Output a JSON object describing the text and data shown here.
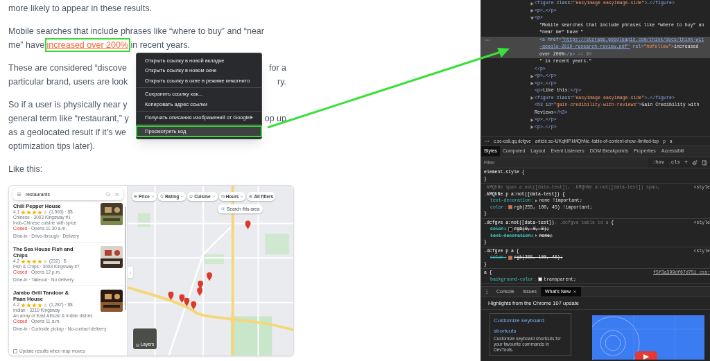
{
  "article": {
    "blocks": [
      {
        "kind": "plain",
        "lines": [
          "more likely to appear in these results."
        ]
      },
      {
        "kind": "linked",
        "lines": [
          "Mobile searches that include phrases like “where to buy” and “near",
          "me” have "
        ],
        "link": "increased over 200%",
        "after": " in recent years."
      },
      {
        "kind": "covered",
        "lines": [
          {
            "left": "These are considered “discove",
            "right": "for a"
          },
          {
            "left": "particular brand, users are look",
            "right": "ry."
          }
        ]
      },
      {
        "kind": "covered",
        "lines": [
          {
            "left": "So if a user is physically near y"
          },
          {
            "left": "general term like “restaurant,” y",
            "right": "op up"
          },
          {
            "left": "as a geolocated result if it’s we"
          },
          {
            "left": "optimization tips later)."
          }
        ]
      },
      {
        "kind": "plain",
        "lines": [
          "Like this:"
        ]
      }
    ]
  },
  "map_screenshot": {
    "search": {
      "value": "restaurants"
    },
    "results": [
      {
        "title": "Chili Pepper House",
        "rating": "4.1",
        "stars": 4,
        "reviews": "(1,563) · $$",
        "lines": [
          "Chinese · 3003 Kingsway #1",
          "Indo-Chinese cuisine with spice"
        ],
        "status": "Closed",
        "hours": " · Opens 11:30 a.m.",
        "services": "Dine-in · Drive-through · Delivery"
      },
      {
        "title": "The Sea House Fish and Chips",
        "rating": "4.2",
        "stars": 4,
        "reviews": "(232) · $",
        "lines": [
          "Fish & Chips · 3003 Kingsway #7"
        ],
        "status": "Closed",
        "hours": " · Opens 12 p.m.",
        "services": "Dine-in · Takeout · No delivery"
      },
      {
        "title": "Jambo Grill Tandoor & Paan House",
        "rating": "4.2",
        "stars": 4,
        "reviews": "(1,287) · $$",
        "lines": [
          "Indian · 3219 Kingsway",
          "An array of East African & Indian dishes"
        ],
        "status": "Closed",
        "hours": " · Opens 11 a.m.",
        "services": "Dine-in · Curbside pickup · No-contact delivery"
      }
    ],
    "update_option": {
      "label": "Update results when map moves",
      "checked": false
    },
    "chips": [
      {
        "label": "Price",
        "dropdown": true
      },
      {
        "label": "Rating",
        "dropdown": true
      },
      {
        "label": "Cuisine",
        "dropdown": true
      },
      {
        "label": "Hours",
        "dropdown": true
      },
      {
        "label": "All filters",
        "dropdown": false
      }
    ],
    "search_area": "Search this area",
    "layers": "Layers"
  },
  "context_menu": {
    "groups": [
      [
        {
          "label": "Открыть ссылку в новой вкладке",
          "highlighted": false,
          "submenu": false
        },
        {
          "label": "Открыть ссылку в новом окне",
          "highlighted": false,
          "submenu": false
        },
        {
          "label": "Открыть ссылку в окне в режиме инкогнито",
          "highlighted": false,
          "submenu": false
        }
      ],
      [
        {
          "label": "Сохранить ссылку как...",
          "highlighted": false,
          "submenu": false
        },
        {
          "label": "Копировать адрес ссылки",
          "highlighted": false,
          "submenu": false
        }
      ],
      [
        {
          "label": "Получать описания изображений от Google",
          "highlighted": false,
          "submenu": true
        }
      ],
      [
        {
          "label": "Просмотреть код",
          "highlighted": true,
          "submenu": false
        }
      ]
    ]
  },
  "elements": {
    "nodes": [
      {
        "selected": false,
        "expanded": false,
        "lines": [
          [
            {
              "kind": "tag",
              "text": "<figure"
            },
            {
              "kind": "attr",
              "text": " class"
            },
            {
              "kind": "tag",
              "text": "="
            },
            {
              "kind": "value",
              "text": "\"easyimage easyimage-side\""
            },
            {
              "kind": "tag",
              "text": ">…</figure>"
            }
          ]
        ]
      },
      {
        "selected": false,
        "expanded": false,
        "lines": [
          [
            {
              "kind": "tag",
              "text": "<p>…</p>"
            }
          ]
        ]
      },
      {
        "selected": false,
        "expanded": true,
        "lines": [
          [
            {
              "kind": "tag",
              "text": "<p>"
            }
          ]
        ],
        "close": [
          {
            "kind": "tag",
            "text": "</p>"
          }
        ],
        "children": [
          {
            "selected": false,
            "lines": [
              [
                {
                  "kind": "text",
                  "text": "\"Mobile searches that include phrases like “where to buy” an"
                }
              ],
              [
                {
                  "kind": "text",
                  "text": "“near me” have \""
                }
              ]
            ]
          },
          {
            "selected": true,
            "lines": [
              [
                {
                  "kind": "tag",
                  "text": "<a"
                },
                {
                  "kind": "attr",
                  "text": " href"
                },
                {
                  "kind": "tag",
                  "text": "="
                },
                {
                  "kind": "link",
                  "text": "\"https://storage.googleapis.com/think/docs/think-wit"
                }
              ],
              [
                {
                  "kind": "link",
                  "text": "-google-2019-research-review.pdf\""
                },
                {
                  "kind": "attr",
                  "text": " rel"
                },
                {
                  "kind": "tag",
                  "text": "="
                },
                {
                  "kind": "value",
                  "text": "\"nofollow\""
                },
                {
                  "kind": "tag",
                  "text": ">"
                },
                {
                  "kind": "text",
                  "text": "increased"
                }
              ],
              [
                {
                  "kind": "text",
                  "text": "over 200%"
                },
                {
                  "kind": "tag",
                  "text": "</a>"
                },
                {
                  "kind": "dim",
                  "text": " == $0"
                }
              ]
            ]
          },
          {
            "selected": false,
            "lines": [
              [
                {
                  "kind": "text",
                  "text": "\" in recent years.\""
                }
              ]
            ]
          }
        ]
      },
      {
        "selected": false,
        "expanded": false,
        "lines": [
          [
            {
              "kind": "tag",
              "text": "<p>…</p>"
            }
          ]
        ]
      },
      {
        "selected": false,
        "expanded": false,
        "lines": [
          [
            {
              "kind": "tag",
              "text": "<p>…</p>"
            }
          ]
        ]
      },
      {
        "selected": false,
        "lines": [
          [
            {
              "kind": "tag",
              "text": "<p>"
            },
            {
              "kind": "text",
              "text": "Like this:"
            },
            {
              "kind": "tag",
              "text": "</p>"
            }
          ]
        ]
      },
      {
        "selected": false,
        "expanded": false,
        "lines": [
          [
            {
              "kind": "tag",
              "text": "<figure"
            },
            {
              "kind": "attr",
              "text": " class"
            },
            {
              "kind": "tag",
              "text": "="
            },
            {
              "kind": "value",
              "text": "\"easyimage easyimage-side\""
            },
            {
              "kind": "tag",
              "text": ">…</figure>"
            }
          ]
        ]
      },
      {
        "selected": false,
        "lines": [
          [
            {
              "kind": "tag",
              "text": "<h3"
            },
            {
              "kind": "attr",
              "text": " id"
            },
            {
              "kind": "tag",
              "text": "="
            },
            {
              "kind": "value",
              "text": "\"gain-credibility-with-reviews\""
            },
            {
              "kind": "tag",
              "text": ">"
            },
            {
              "kind": "text",
              "text": "Gain Credibility with"
            }
          ],
          [
            {
              "kind": "text",
              "text": "Reviews"
            },
            {
              "kind": "tag",
              "text": "</h3>"
            }
          ]
        ]
      },
      {
        "selected": false,
        "expanded": false,
        "lines": [
          [
            {
              "kind": "tag",
              "text": "<p>…</p>"
            }
          ]
        ]
      },
      {
        "selected": false,
        "expanded": false,
        "lines": [
          [
            {
              "kind": "tag",
              "text": "<p>…</p>"
            }
          ]
        ]
      }
    ]
  },
  "breadcrumbs": [
    "c.sc-caiLqq.dcfgve",
    "article.sc-iUKqMP.kMQhNe.-table-of-content-show.-limited-top",
    "p",
    "a"
  ],
  "sidebar_tabs": [
    {
      "label": "Styles",
      "selected": true
    },
    {
      "label": "Computed",
      "selected": false
    },
    {
      "label": "Layout",
      "selected": false
    },
    {
      "label": "Event Listeners",
      "selected": false
    },
    {
      "label": "DOM Breakpoints",
      "selected": false
    },
    {
      "label": "Properties",
      "selected": false
    },
    {
      "label": "Accessibili",
      "selected": false
    }
  ],
  "styles_toolbar": {
    "filter_placeholder": "Filter",
    "hov": ":hov",
    "cls": ".cls",
    "add": "+"
  },
  "style_rules": [
    {
      "selectors": [
        [
          {
            "text": "element.style {",
            "matched": true
          }
        ]
      ],
      "close": "}"
    },
    {
      "source": "<style",
      "selectors": [
        [
          {
            "text": ".kMQhNe span a:not([data-test]), .kMQhNe a:not([data-test]) span,",
            "matched": false
          }
        ],
        [
          {
            "text": ".kMQhNe p a:not([data-test])",
            "matched": true
          },
          {
            "text": " {",
            "matched": true
          }
        ]
      ],
      "properties": [
        {
          "name": "text-decoration:",
          "value": "none !important;",
          "expandable": true,
          "struck": false
        },
        {
          "name": "color:",
          "value": "rgb(255, 100, 45) !important;",
          "color": "#ff642d",
          "expandable": false,
          "struck": false
        }
      ],
      "close": "}"
    },
    {
      "source": "<style",
      "selectors": [
        [
          {
            "text": ".dcfgve a:not([data-test])",
            "matched": true
          },
          {
            "text": ", .dcfgve table td a",
            "matched": false
          },
          {
            "text": " {",
            "matched": true
          }
        ]
      ],
      "properties": [
        {
          "name": "color:",
          "value": "rgb(0, 0, 0);",
          "color": "#000000",
          "expandable": false,
          "struck": true
        },
        {
          "name": "text-decoration:",
          "value": "none;",
          "expandable": true,
          "struck": true
        }
      ],
      "close": "}"
    },
    {
      "source": "<style",
      "selectors": [
        [
          {
            "text": ".dcfgve p a {",
            "matched": true
          }
        ]
      ],
      "properties": [
        {
          "name": "color:",
          "value": "rgb(255, 100, 45);",
          "color": "#ff642d",
          "expandable": false,
          "struck": true
        }
      ],
      "close": "}"
    },
    {
      "source": "f5f3a399df67d751.css:",
      "selectors": [
        [
          {
            "text": "a {",
            "matched": true
          }
        ]
      ],
      "properties": [
        {
          "name": "background-color:",
          "value": "transparent;",
          "color": "#ffffff",
          "expandable": false,
          "struck": false
        }
      ]
    }
  ],
  "drawer": {
    "tabs": [
      {
        "label": "Console",
        "selected": false
      },
      {
        "label": "Issues",
        "selected": false
      },
      {
        "label": "What's New",
        "selected": true
      }
    ],
    "heading": "Highlights from the Chrome 107 update",
    "card": {
      "title": "Customize keyboard shortcuts",
      "description": "Customize keyboard shortcuts for your favourite commands in DevTools."
    }
  }
}
